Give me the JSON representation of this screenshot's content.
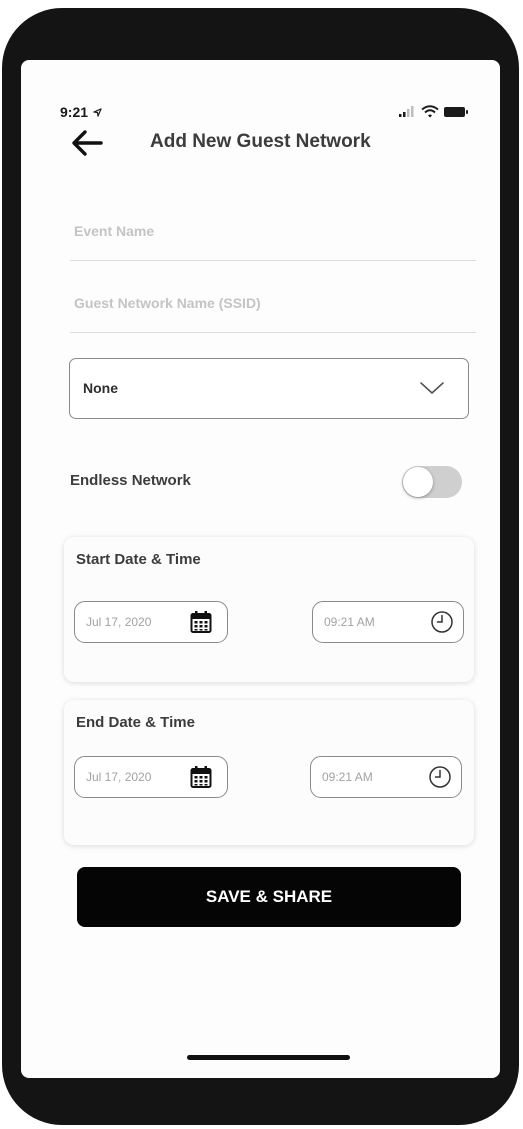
{
  "status_bar": {
    "time": "9:21",
    "icons": [
      "location-icon",
      "signal-icon",
      "wifi-icon",
      "battery-icon"
    ]
  },
  "header": {
    "back_icon": "back-arrow-icon",
    "title": "Add New Guest Network"
  },
  "form": {
    "event_name": {
      "placeholder": "Event Name",
      "value": ""
    },
    "ssid": {
      "placeholder": "Guest Network Name (SSID)",
      "value": ""
    },
    "security_dropdown": {
      "selected": "None",
      "icon": "chevron-down-icon"
    },
    "endless_network": {
      "label": "Endless Network",
      "enabled": false
    }
  },
  "start": {
    "title": "Start Date & Time",
    "date": "Jul 17, 2020",
    "time": "09:21 AM"
  },
  "end": {
    "title": "End Date & Time",
    "date": "Jul 17, 2020",
    "time": "09:21 AM"
  },
  "actions": {
    "save_label": "SAVE & SHARE"
  },
  "colors": {
    "frame": "#141414",
    "button": "#050505",
    "toggle_off": "#cfcfcf",
    "placeholder": "#c4c4c4"
  }
}
